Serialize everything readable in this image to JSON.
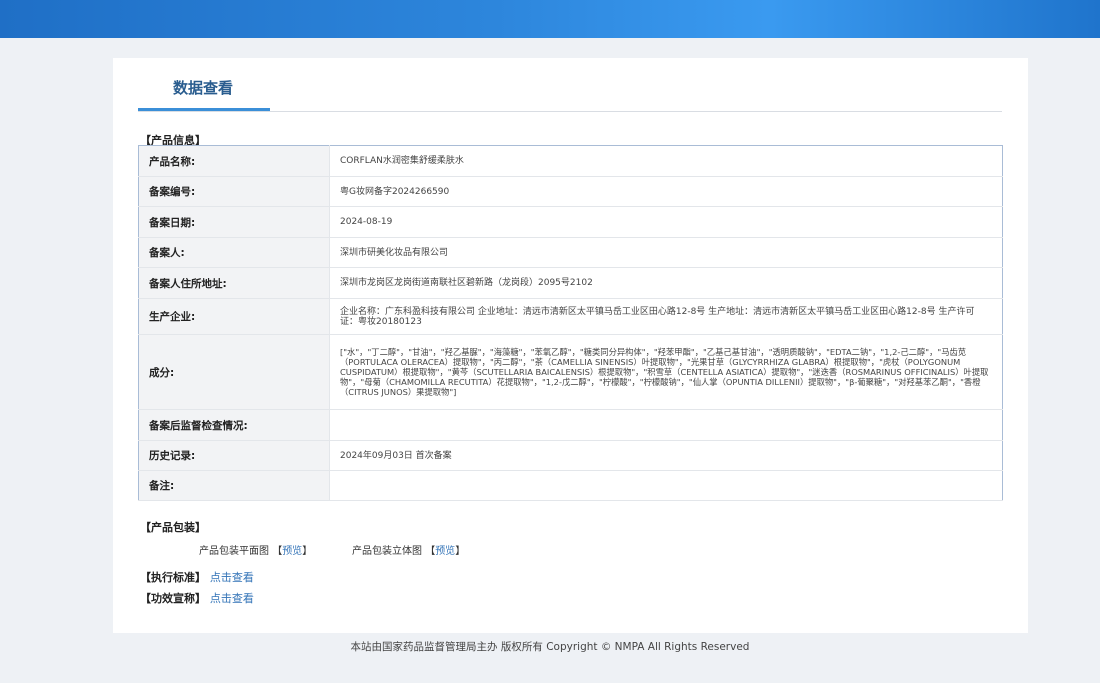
{
  "tab_title": "数据查看",
  "product_info_title": "【产品信息】",
  "rows": [
    {
      "label": "产品名称:",
      "value": "CORFLAN水润密集舒缓柔肤水"
    },
    {
      "label": "备案编号:",
      "value": "粤G妆网备字2024266590"
    },
    {
      "label": "备案日期:",
      "value": "2024-08-19"
    },
    {
      "label": "备案人:",
      "value": "深圳市研美化妆品有限公司"
    },
    {
      "label": "备案人住所地址:",
      "value": "深圳市龙岗区龙岗街道南联社区碧新路（龙岗段）2095号2102"
    },
    {
      "label": "生产企业:",
      "value": "企业名称：广东科盈科技有限公司 企业地址：清远市清新区太平镇马岳工业区田心路12-8号 生产地址：清远市清新区太平镇马岳工业区田心路12-8号 生产许可证：粤妆20180123"
    },
    {
      "label": "成分:",
      "value": "[\"水\"，\"丁二醇\"，\"甘油\"，\"羟乙基脲\"，\"海藻糖\"，\"苯氧乙醇\"，\"糖类同分异构体\"，\"羟苯甲酯\"，\"乙基己基甘油\"，\"透明质酸钠\"，\"EDTA二钠\"，\"1,2-己二醇\"，\"马齿苋（PORTULACA OLERACEA）提取物\"，\"丙二醇\"，\"茶（CAMELLIA SINENSIS）叶提取物\"，\"光果甘草（GLYCYRRHIZA GLABRA）根提取物\"，\"虎杖（POLYGONUM CUSPIDATUM）根提取物\"，\"黄芩（SCUTELLARIA BAICALENSIS）根提取物\"，\"积雪草（CENTELLA ASIATICA）提取物\"，\"迷迭香（ROSMARINUS OFFICINALIS）叶提取物\"，\"母菊（CHAMOMILLA RECUTITA）花提取物\"，\"1,2-戊二醇\"，\"柠檬酸\"，\"柠檬酸钠\"，\"仙人掌（OPUNTIA DILLENII）提取物\"，\"β-葡聚糖\"，\"对羟基苯乙酮\"，\"香橙（CITRUS JUNOS）果提取物\"]"
    },
    {
      "label": "备案后监督检查情况:",
      "value": ""
    },
    {
      "label": "历史记录:",
      "value": "2024年09月03日 首次备案"
    },
    {
      "label": "备注:",
      "value": ""
    }
  ],
  "packaging_title": "【产品包装】",
  "pkg_flat_label": "产品包装平面图",
  "pkg_3d_label": "产品包装立体图",
  "preview_link": "预览",
  "bracket_open": "【",
  "bracket_close": "】",
  "standard_label": "【执行标准】",
  "efficacy_label": "【功效宣称】",
  "view_link": "点击查看",
  "footer": "本站由国家药品监督管理局主办 版权所有 Copyright © NMPA All Rights Reserved"
}
